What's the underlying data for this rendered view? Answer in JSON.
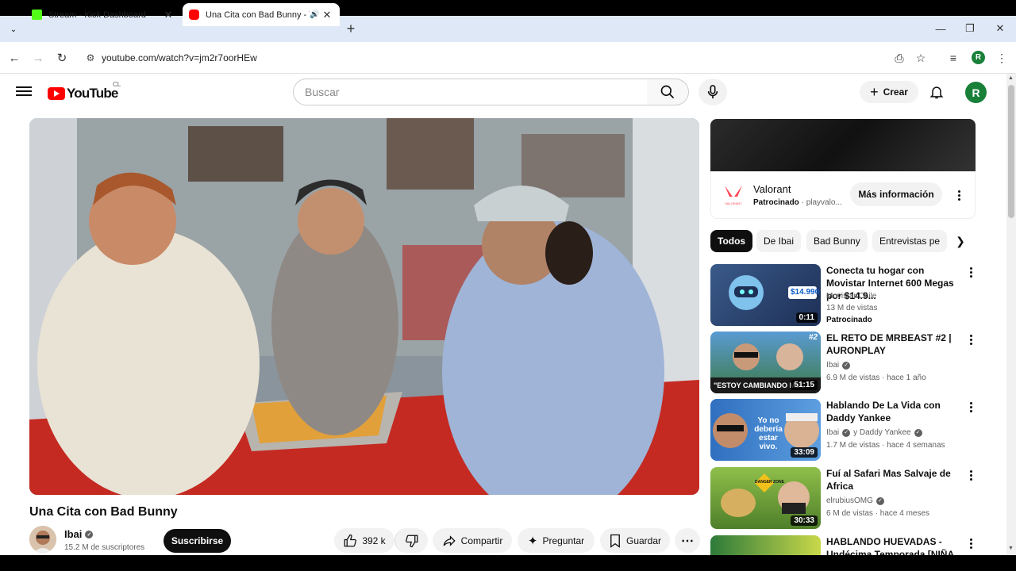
{
  "browser": {
    "tabs": [
      {
        "title": "Stream - Kick Dashboard",
        "active": false,
        "favicon_color": "#53fc18"
      },
      {
        "title": "Una Cita con Bad Bunny - Y",
        "active": true,
        "favicon_color": "#ff0000"
      }
    ],
    "url": "youtube.com/watch?v=jm2r7oorHEw",
    "profile_initial": "R"
  },
  "header": {
    "logo": "YouTube",
    "country": "CL",
    "search_placeholder": "Buscar",
    "create_label": "Crear",
    "avatar_initial": "R"
  },
  "video": {
    "title": "Una Cita con Bad Bunny",
    "channel": "Ibai",
    "subscribers": "15.2 M de suscriptores",
    "subscribe_label": "Suscribirse",
    "likes": "392 k",
    "share_label": "Compartir",
    "ask_label": "Preguntar",
    "save_label": "Guardar"
  },
  "ad": {
    "title": "Valorant",
    "sponsored": "Patrocinado",
    "domain": "playvalo...",
    "button": "Más información",
    "logo_text": "VALORANT"
  },
  "chips": [
    "Todos",
    "De Ibai",
    "Bad Bunny",
    "Entrevistas pe"
  ],
  "recommendations": [
    {
      "title": "Conecta tu hogar con Movistar Internet 600 Megas por $14.9...",
      "channel": "Movistar Chile",
      "views": "13 M de vistas",
      "extra": "Patrocinado",
      "duration": "0:11",
      "thumb_text": "$14.990"
    },
    {
      "title": "EL RETO DE MRBEAST #2 | AURONPLAY",
      "channel": "Ibai",
      "views": "6.9 M de vistas · hace 1 año",
      "duration": "51:15",
      "thumb_text": "\"ESTOY CAMBIANDO MUC",
      "badge": "#2"
    },
    {
      "title": "Hablando De La Vida con Daddy Yankee",
      "channel": "Ibai",
      "channel2": "y Daddy Yankee",
      "views": "1.7 M de vistas · hace 4 semanas",
      "duration": "33:09",
      "thumb_text": "Yo no debería estar vivo."
    },
    {
      "title": "Fuí al Safari Mas Salvaje de Africa",
      "channel": "elrubiusOMG",
      "views": "6 M de vistas · hace 4 meses",
      "duration": "30:33",
      "thumb_text": "DANGER ZONE"
    },
    {
      "title": "HABLANDO HUEVADAS - Undécima Temporada [NIÑA"
    }
  ],
  "colors": {
    "accent": "#ff0000",
    "dark": "#0f0f0f",
    "chip_bg": "#f2f2f2"
  }
}
